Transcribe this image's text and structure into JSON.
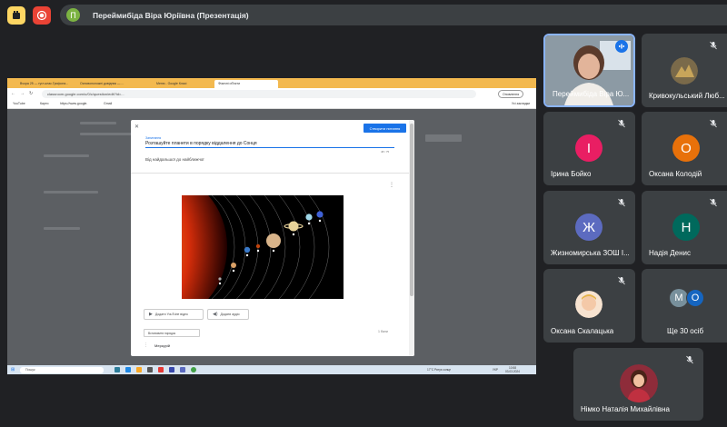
{
  "top": {
    "presenter_initial": "П",
    "presenter_title": "Переймибіда Віра Юріївна (Презентація)"
  },
  "screen": {
    "tabs": [
      "Вчора 25 — гугл-клас.Грифона...",
      "Основоположні довідник — ...",
      "Меню - Google Класі",
      "Фізичні об'єкти"
    ],
    "url": "classroom.google.com/u/0/c/question/edit?id=...",
    "update_label": "Оновлення",
    "bookmarks": [
      "YouTube",
      "Карти",
      "https://www.google.",
      "Gmail",
      "Усі закладки"
    ],
    "modal": {
      "save_label": "Створити питання",
      "question_label": "Запитання",
      "question_text": "Розташуйте планети в порядку віддалення до Сонця",
      "char_count": "48 / 75",
      "hint": "Від найдальшої до найближчої",
      "youtube_label": "Додати YouTube відео",
      "audio_label": "Додати аудіо",
      "answer_type": "Встановити порядок",
      "score": "1 бали",
      "answer_1": "Меркурій"
    },
    "taskbar": {
      "search_placeholder": "Пошук",
      "weather": "17°C  Рятує сонце",
      "lang": "УКР",
      "time": "10:58",
      "date": "03.03.2024"
    }
  },
  "participants": [
    {
      "name": "Переймибіда Віра Ю...",
      "initial": "",
      "color": "",
      "speaking": true
    },
    {
      "name": "Кривокульський Люб...",
      "initial": "",
      "color": "",
      "muted": true
    },
    {
      "name": "Ірина Бойко",
      "initial": "І",
      "color": "#e91e63",
      "muted": true
    },
    {
      "name": "Оксана Колодій",
      "initial": "О",
      "color": "#e8710a",
      "muted": true
    },
    {
      "name": "Жизномирська ЗОШ І...",
      "initial": "Ж",
      "color": "#5c6bc0",
      "muted": true
    },
    {
      "name": "Надія Денис",
      "initial": "Н",
      "color": "#00695c",
      "muted": true
    },
    {
      "name": "Оксана Скалацька",
      "initial": "",
      "color": "",
      "muted": true
    },
    {
      "name": "Ще 30 осіб",
      "initial": "",
      "color": ""
    },
    {
      "name": "Німко Наталія Михайлівна",
      "initial": "",
      "color": "",
      "muted": true
    }
  ],
  "more": {
    "initials": [
      "М",
      "О"
    ],
    "colors": [
      "#78909c",
      "#1565c0"
    ]
  }
}
